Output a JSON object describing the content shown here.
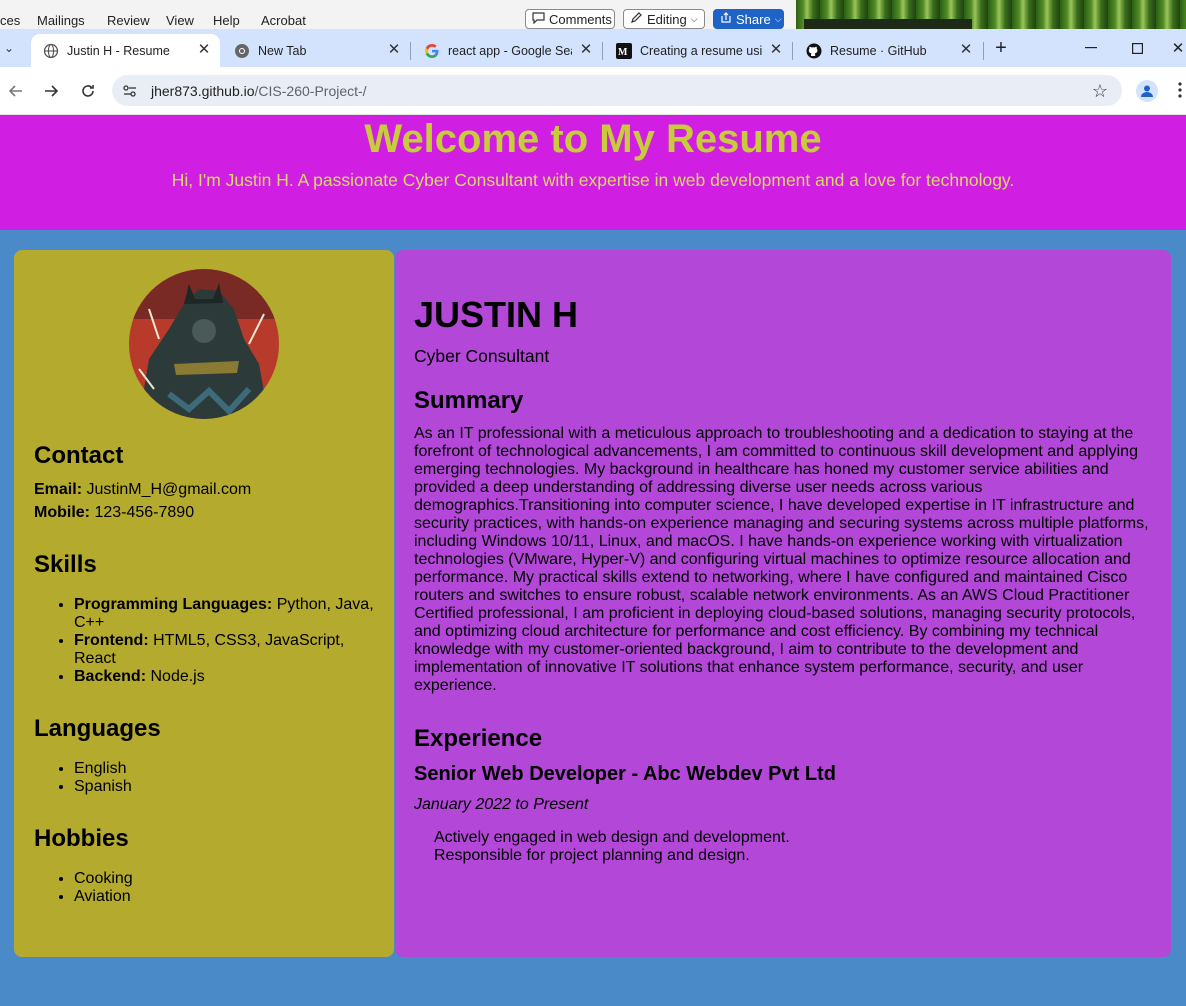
{
  "word_ribbon": {
    "menus": [
      "ces",
      "Mailings",
      "Review",
      "View",
      "Help",
      "Acrobat"
    ],
    "comments_label": "Comments",
    "editing_label": "Editing",
    "share_label": "Share"
  },
  "browser": {
    "tabs": [
      {
        "title": "Justin H - Resume",
        "icon": "globe-icon",
        "active": true
      },
      {
        "title": "New Tab",
        "icon": "chrome-icon",
        "active": false
      },
      {
        "title": "react app - Google Sea",
        "icon": "google-icon",
        "active": false
      },
      {
        "title": "Creating a resume usin",
        "icon": "medium-icon",
        "active": false
      },
      {
        "title": "Resume · GitHub",
        "icon": "github-icon",
        "active": false
      }
    ],
    "url_host": "jher873.github.io",
    "url_path": "/CIS-260-Project-/",
    "accent": "#d3e3fd"
  },
  "page": {
    "header": {
      "title": "Welcome to My Resume",
      "subtitle": "Hi, I'm Justin H. A passionate Cyber Consultant with expertise in web development and a love for technology.",
      "bg": "#d01ee3",
      "title_color": "#c8cc3c"
    },
    "sidebar": {
      "bg": "#b4aa2e",
      "contact_heading": "Contact",
      "email_label": "Email:",
      "email_value": "JustinM_H@gmail.com",
      "mobile_label": "Mobile:",
      "mobile_value": "123-456-7890",
      "skills_heading": "Skills",
      "skills": [
        {
          "label": "Programming Languages:",
          "value": "Python, Java, C++"
        },
        {
          "label": "Frontend:",
          "value": "HTML5, CSS3, JavaScript, React"
        },
        {
          "label": "Backend:",
          "value": "Node.js"
        }
      ],
      "languages_heading": "Languages",
      "languages": [
        "English",
        "Spanish"
      ],
      "hobbies_heading": "Hobbies",
      "hobbies": [
        "Cooking",
        "Aviation"
      ]
    },
    "main": {
      "bg": "#b247d8",
      "name": "JUSTIN H",
      "role": "Cyber Consultant",
      "summary_heading": "Summary",
      "summary": "As an IT professional with a meticulous approach to troubleshooting and a dedication to staying at the forefront of technological advancements, I am committed to continuous skill development and applying emerging technologies. My background in healthcare has honed my customer service abilities and provided a deep understanding of addressing diverse user needs across various demographics.Transitioning into computer science, I have developed expertise in IT infrastructure and security practices, with hands-on experience managing and securing systems across multiple platforms, including Windows 10/11, Linux, and macOS. I have hands-on experience working with virtualization technologies (VMware, Hyper-V) and configuring virtual machines to optimize resource allocation and performance. My practical skills extend to networking, where I have configured and maintained Cisco routers and switches to ensure robust, scalable network environments. As an AWS Cloud Practitioner Certified professional, I am proficient in deploying cloud-based solutions, managing security protocols, and optimizing cloud architecture for performance and cost efficiency. By combining my technical knowledge with my customer-oriented background, I aim to contribute to the development and implementation of innovative IT solutions that enhance system performance, security, and user experience.",
      "experience_heading": "Experience",
      "job_title": "Senior Web Developer - Abc Webdev Pvt Ltd",
      "job_dates": "January 2022 to Present",
      "duties": [
        "Actively engaged in web design and development.",
        "Responsible for project planning and design."
      ]
    },
    "page_bg": "#4a8ac9"
  }
}
